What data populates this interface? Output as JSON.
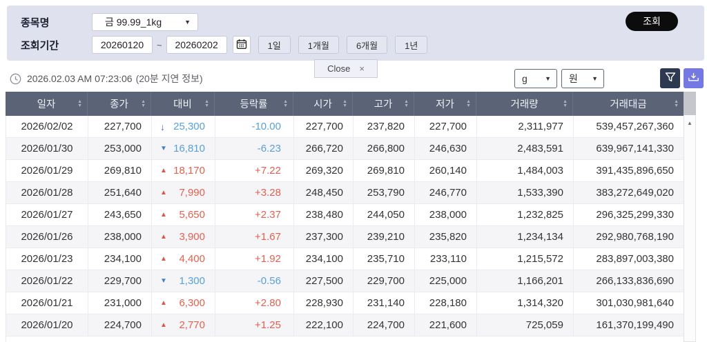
{
  "colors": {
    "panel_bg": "#dfe1ef",
    "table_header_bg": "#5b6477",
    "row_alt_bg": "#f5f5f8",
    "up_red": "#e0614e",
    "down_blue": "#58a0d8",
    "arrow_up_red": "#d75848",
    "arrow_down_blue": "#4a7fc1",
    "search_button_bg": "#0c0c0c",
    "filter_button_bg": "#2d3950",
    "download_button_bg": "#7378e3"
  },
  "top_panel": {
    "item_label": "종목명",
    "item_value": "금 99.99_1kg",
    "period_label": "조회기간",
    "date_from": "20260120",
    "date_to": "20260202",
    "period_buttons": [
      "1일",
      "1개월",
      "6개월",
      "1년"
    ],
    "search_button": "조회"
  },
  "close_tab": {
    "label": "Close",
    "close_icon": "×"
  },
  "info_bar": {
    "timestamp": "2026.02.03 AM 07:23:06",
    "delay_note": "(20분 지연 정보)",
    "unit_weight": "g",
    "unit_currency": "원"
  },
  "glyphs": {
    "caret": "▼",
    "tilde": "~",
    "sort_up": "▲",
    "sort_down": "▼",
    "arrow_up": "▲",
    "arrow_down": "▼",
    "arrow_limit_down": "↓",
    "scroll_up": "▲"
  },
  "table": {
    "headers": [
      "일자",
      "종가",
      "대비",
      "등락률",
      "시가",
      "고가",
      "저가",
      "거래량",
      "거래대금"
    ],
    "rows": [
      {
        "date": "2026/02/02",
        "close": "227,700",
        "dir": "limit-down",
        "change": "25,300",
        "rate": "-10.00",
        "open": "227,700",
        "high": "237,820",
        "low": "227,700",
        "volume": "2,311,977",
        "value": "539,457,267,360"
      },
      {
        "date": "2026/01/30",
        "close": "253,000",
        "dir": "down",
        "change": "16,810",
        "rate": "-6.23",
        "open": "266,720",
        "high": "266,800",
        "low": "246,630",
        "volume": "2,483,591",
        "value": "639,967,141,330"
      },
      {
        "date": "2026/01/29",
        "close": "269,810",
        "dir": "up",
        "change": "18,170",
        "rate": "+7.22",
        "open": "269,320",
        "high": "269,810",
        "low": "260,140",
        "volume": "1,484,003",
        "value": "391,435,896,650"
      },
      {
        "date": "2026/01/28",
        "close": "251,640",
        "dir": "up",
        "change": "7,990",
        "rate": "+3.28",
        "open": "248,450",
        "high": "253,790",
        "low": "246,770",
        "volume": "1,533,390",
        "value": "383,272,649,020"
      },
      {
        "date": "2026/01/27",
        "close": "243,650",
        "dir": "up",
        "change": "5,650",
        "rate": "+2.37",
        "open": "238,480",
        "high": "244,050",
        "low": "238,000",
        "volume": "1,232,825",
        "value": "296,325,299,330"
      },
      {
        "date": "2026/01/26",
        "close": "238,000",
        "dir": "up",
        "change": "3,900",
        "rate": "+1.67",
        "open": "237,300",
        "high": "239,210",
        "low": "235,820",
        "volume": "1,234,134",
        "value": "292,980,768,190"
      },
      {
        "date": "2026/01/23",
        "close": "234,100",
        "dir": "up",
        "change": "4,400",
        "rate": "+1.92",
        "open": "234,100",
        "high": "235,710",
        "low": "233,110",
        "volume": "1,215,572",
        "value": "283,897,003,380"
      },
      {
        "date": "2026/01/22",
        "close": "229,700",
        "dir": "down",
        "change": "1,300",
        "rate": "-0.56",
        "open": "227,500",
        "high": "229,700",
        "low": "225,000",
        "volume": "1,166,201",
        "value": "266,133,836,690"
      },
      {
        "date": "2026/01/21",
        "close": "231,000",
        "dir": "up",
        "change": "6,300",
        "rate": "+2.80",
        "open": "228,930",
        "high": "231,140",
        "low": "228,180",
        "volume": "1,314,320",
        "value": "301,030,981,640"
      },
      {
        "date": "2026/01/20",
        "close": "224,700",
        "dir": "up",
        "change": "2,770",
        "rate": "+1.25",
        "open": "222,100",
        "high": "224,700",
        "low": "221,600",
        "volume": "725,059",
        "value": "161,370,199,490"
      }
    ]
  }
}
